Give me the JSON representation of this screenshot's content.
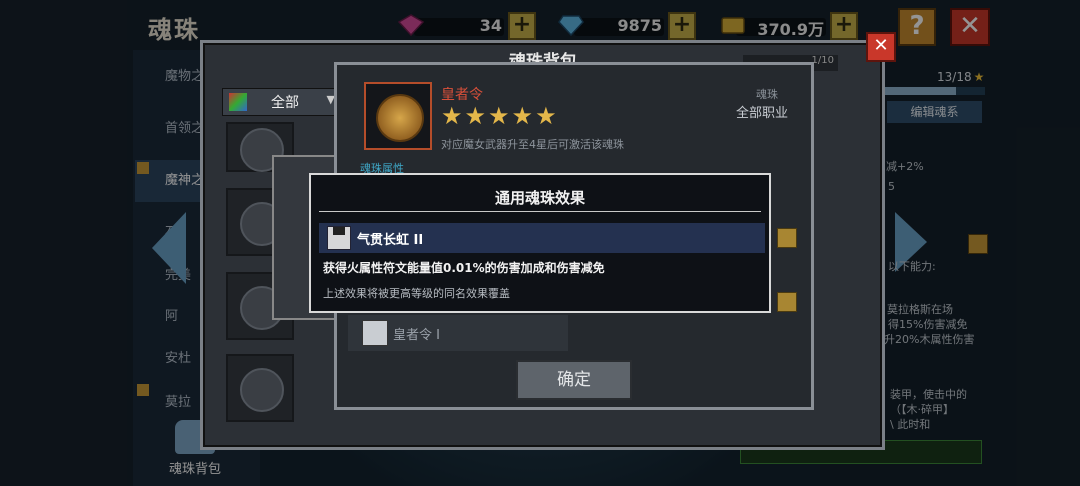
{
  "screen": {
    "title": "魂珠"
  },
  "resources": [
    {
      "icon": "pink-gem-icon",
      "value": "34"
    },
    {
      "icon": "blue-diamond-icon",
      "value": "9875"
    },
    {
      "icon": "gold-coin-icon",
      "value": "370.9万"
    }
  ],
  "buttons": {
    "help": "?",
    "close": "✕",
    "plus": "+"
  },
  "sidebar": {
    "items": [
      {
        "label": "魔物之"
      },
      {
        "label": "首领之"
      },
      {
        "label": "魔神之"
      },
      {
        "label": "石"
      },
      {
        "label": "完美"
      },
      {
        "label": "阿"
      },
      {
        "label": "安杜"
      },
      {
        "label": "莫拉"
      }
    ],
    "bag_label": "魂珠背包"
  },
  "right_panel": {
    "count": "13/18",
    "progress": 0.72,
    "edit_button": "编辑魂系",
    "text_lines": [
      "减+2%",
      "5",
      "以下能力:",
      "，莫拉格斯在场",
      "得15%伤害减免",
      "升20%木属性伤害",
      "装甲，使击中的",
      "（【木·碎甲】",
      "\\      此时和"
    ]
  },
  "bag_panel": {
    "title": "魂珠背包",
    "close": "✕",
    "header_text": "1/10",
    "filter": {
      "selected": "全部",
      "caret": "▼"
    }
  },
  "detail": {
    "name": "皇者令",
    "stars": "★★★★★",
    "description": "对应魔女武器升至4星后可激活该魂珠",
    "type": "魂珠",
    "job": "全部职业",
    "attr_heading": "魂珠属性",
    "row_label": "皇者令 I",
    "confirm": "确定"
  },
  "popup": {
    "title": "通用魂珠效果",
    "effect_name": "气贯长虹 II",
    "effect_desc": "获得火属性符文能量值0.01%的伤害加成和伤害减免",
    "note": "上述效果将被更高等级的同名效果覆盖"
  },
  "colors": {
    "accent_gold": "#e4b74a",
    "name_red": "#d9503a",
    "attr_blue": "#3fa9c9",
    "danger": "#c9372a"
  }
}
